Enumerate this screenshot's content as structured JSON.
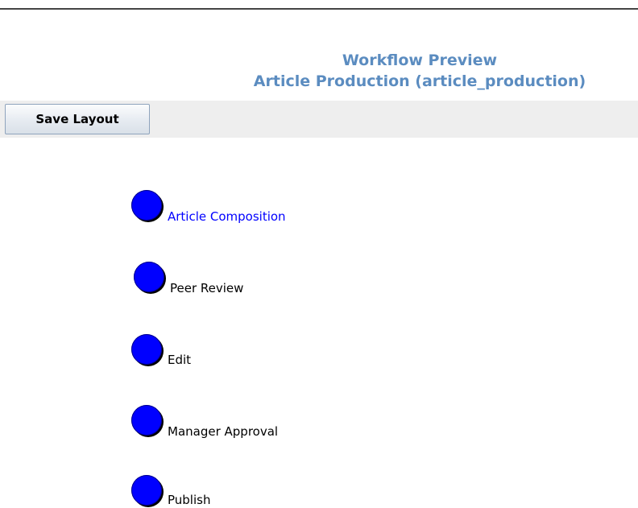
{
  "header": {
    "title": "Workflow Preview",
    "subtitle": "Article Production (article_production)"
  },
  "toolbar": {
    "save_label": "Save Layout"
  },
  "workflow": {
    "nodes": [
      {
        "label": "Article Composition",
        "selected": true
      },
      {
        "label": "Peer Review",
        "selected": false
      },
      {
        "label": "Edit",
        "selected": false
      },
      {
        "label": "Manager Approval",
        "selected": false
      },
      {
        "label": "Publish",
        "selected": false
      }
    ]
  },
  "colors": {
    "title": "#5b8cc0",
    "node_fill": "#0000ff",
    "selected_label": "#0000ff",
    "toolbar_bg": "#eeeeee"
  }
}
